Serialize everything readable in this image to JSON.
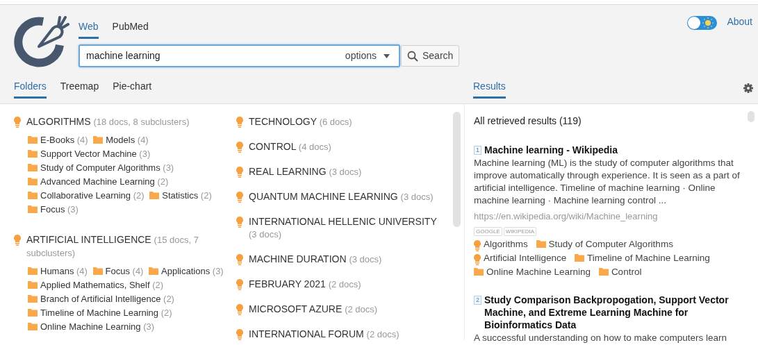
{
  "header": {
    "source_tabs": [
      {
        "label": "Web",
        "selected": true
      },
      {
        "label": "PubMed",
        "selected": false
      }
    ],
    "search": {
      "value": "machine learning",
      "options_label": "options"
    },
    "search_button": "Search",
    "theme_toggle": {
      "checked": false
    },
    "about_link": "About"
  },
  "view_tabs": [
    {
      "label": "Folders",
      "selected": true
    },
    {
      "label": "Treemap",
      "selected": false
    },
    {
      "label": "Pie-chart",
      "selected": false
    }
  ],
  "results_tab": {
    "label": "Results",
    "selected": true
  },
  "cluster_columns": [
    [
      {
        "label": "ALGORITHMS",
        "count": "(18 docs, 8 subclusters)",
        "subclusters": [
          {
            "label": "E-Books",
            "count": "(4)"
          },
          {
            "label": "Models",
            "count": "(4)"
          },
          {
            "label": "Support Vector Machine",
            "count": "(3)"
          },
          {
            "label": "Study of Computer Algorithms",
            "count": "(3)"
          },
          {
            "label": "Advanced Machine Learning",
            "count": "(2)"
          },
          {
            "label": "Collaborative Learning",
            "count": "(2)"
          },
          {
            "label": "Statistics",
            "count": "(2)"
          },
          {
            "label": "Focus",
            "count": "(3)"
          }
        ]
      },
      {
        "label": "ARTIFICIAL INTELLIGENCE",
        "count": "(15 docs, 7 subclusters)",
        "subclusters": [
          {
            "label": "Humans",
            "count": "(4)"
          },
          {
            "label": "Focus",
            "count": "(4)"
          },
          {
            "label": "Applications",
            "count": "(3)"
          },
          {
            "label": "Applied Mathematics, Shelf",
            "count": "(2)"
          },
          {
            "label": "Branch of Artificial Intelligence",
            "count": "(2)"
          },
          {
            "label": "Timeline of Machine Learning",
            "count": "(2)"
          },
          {
            "label": "Online Machine Learning",
            "count": "(3)"
          }
        ]
      }
    ],
    [
      {
        "label": "TECHNOLOGY",
        "count": "(6 docs)"
      },
      {
        "label": "CONTROL",
        "count": "(4 docs)"
      },
      {
        "label": "REAL LEARNING",
        "count": "(3 docs)"
      },
      {
        "label": "QUANTUM MACHINE LEARNING",
        "count": "(3 docs)"
      },
      {
        "label": "INTERNATIONAL HELLENIC UNIVERSITY",
        "count": "(3 docs)"
      },
      {
        "label": "MACHINE DURATION",
        "count": "(3 docs)"
      },
      {
        "label": "FEBRUARY 2021",
        "count": "(2 docs)"
      },
      {
        "label": "MICROSOFT AZURE",
        "count": "(2 docs)"
      },
      {
        "label": "INTERNATIONAL FORUM",
        "count": "(2 docs)"
      }
    ]
  ],
  "results": {
    "summary": "All retrieved results (119)",
    "items": [
      {
        "number": "1",
        "title": "Machine learning - Wikipedia",
        "snippet": "Machine learning (ML) is the study of computer algorithms that improve automatically through experience. It is seen as a part of artificial intelligence. Timeline of machine learning · Online machine learning · Machine learning control ...",
        "url": "https://en.wikipedia.org/wiki/Machine_learning",
        "sources": [
          "GOOGLE",
          "WIKIPEDIA"
        ],
        "tags": [
          {
            "kind": "cluster",
            "label": "Algorithms"
          },
          {
            "kind": "subcluster",
            "label": "Study of Computer Algorithms"
          },
          {
            "kind": "cluster",
            "label": "Artificial Intelligence"
          },
          {
            "kind": "subcluster",
            "label": "Timeline of Machine Learning"
          },
          {
            "kind": "subcluster",
            "label": "Online Machine Learning"
          },
          {
            "kind": "subcluster",
            "label": "Control"
          }
        ]
      },
      {
        "number": "2",
        "title": "Study Comparison Backpropogation, Support Vector Machine, and Extreme Learning Machine for Bioinformatics Data",
        "snippet": "A successful understanding on how to make computers learn"
      }
    ]
  }
}
